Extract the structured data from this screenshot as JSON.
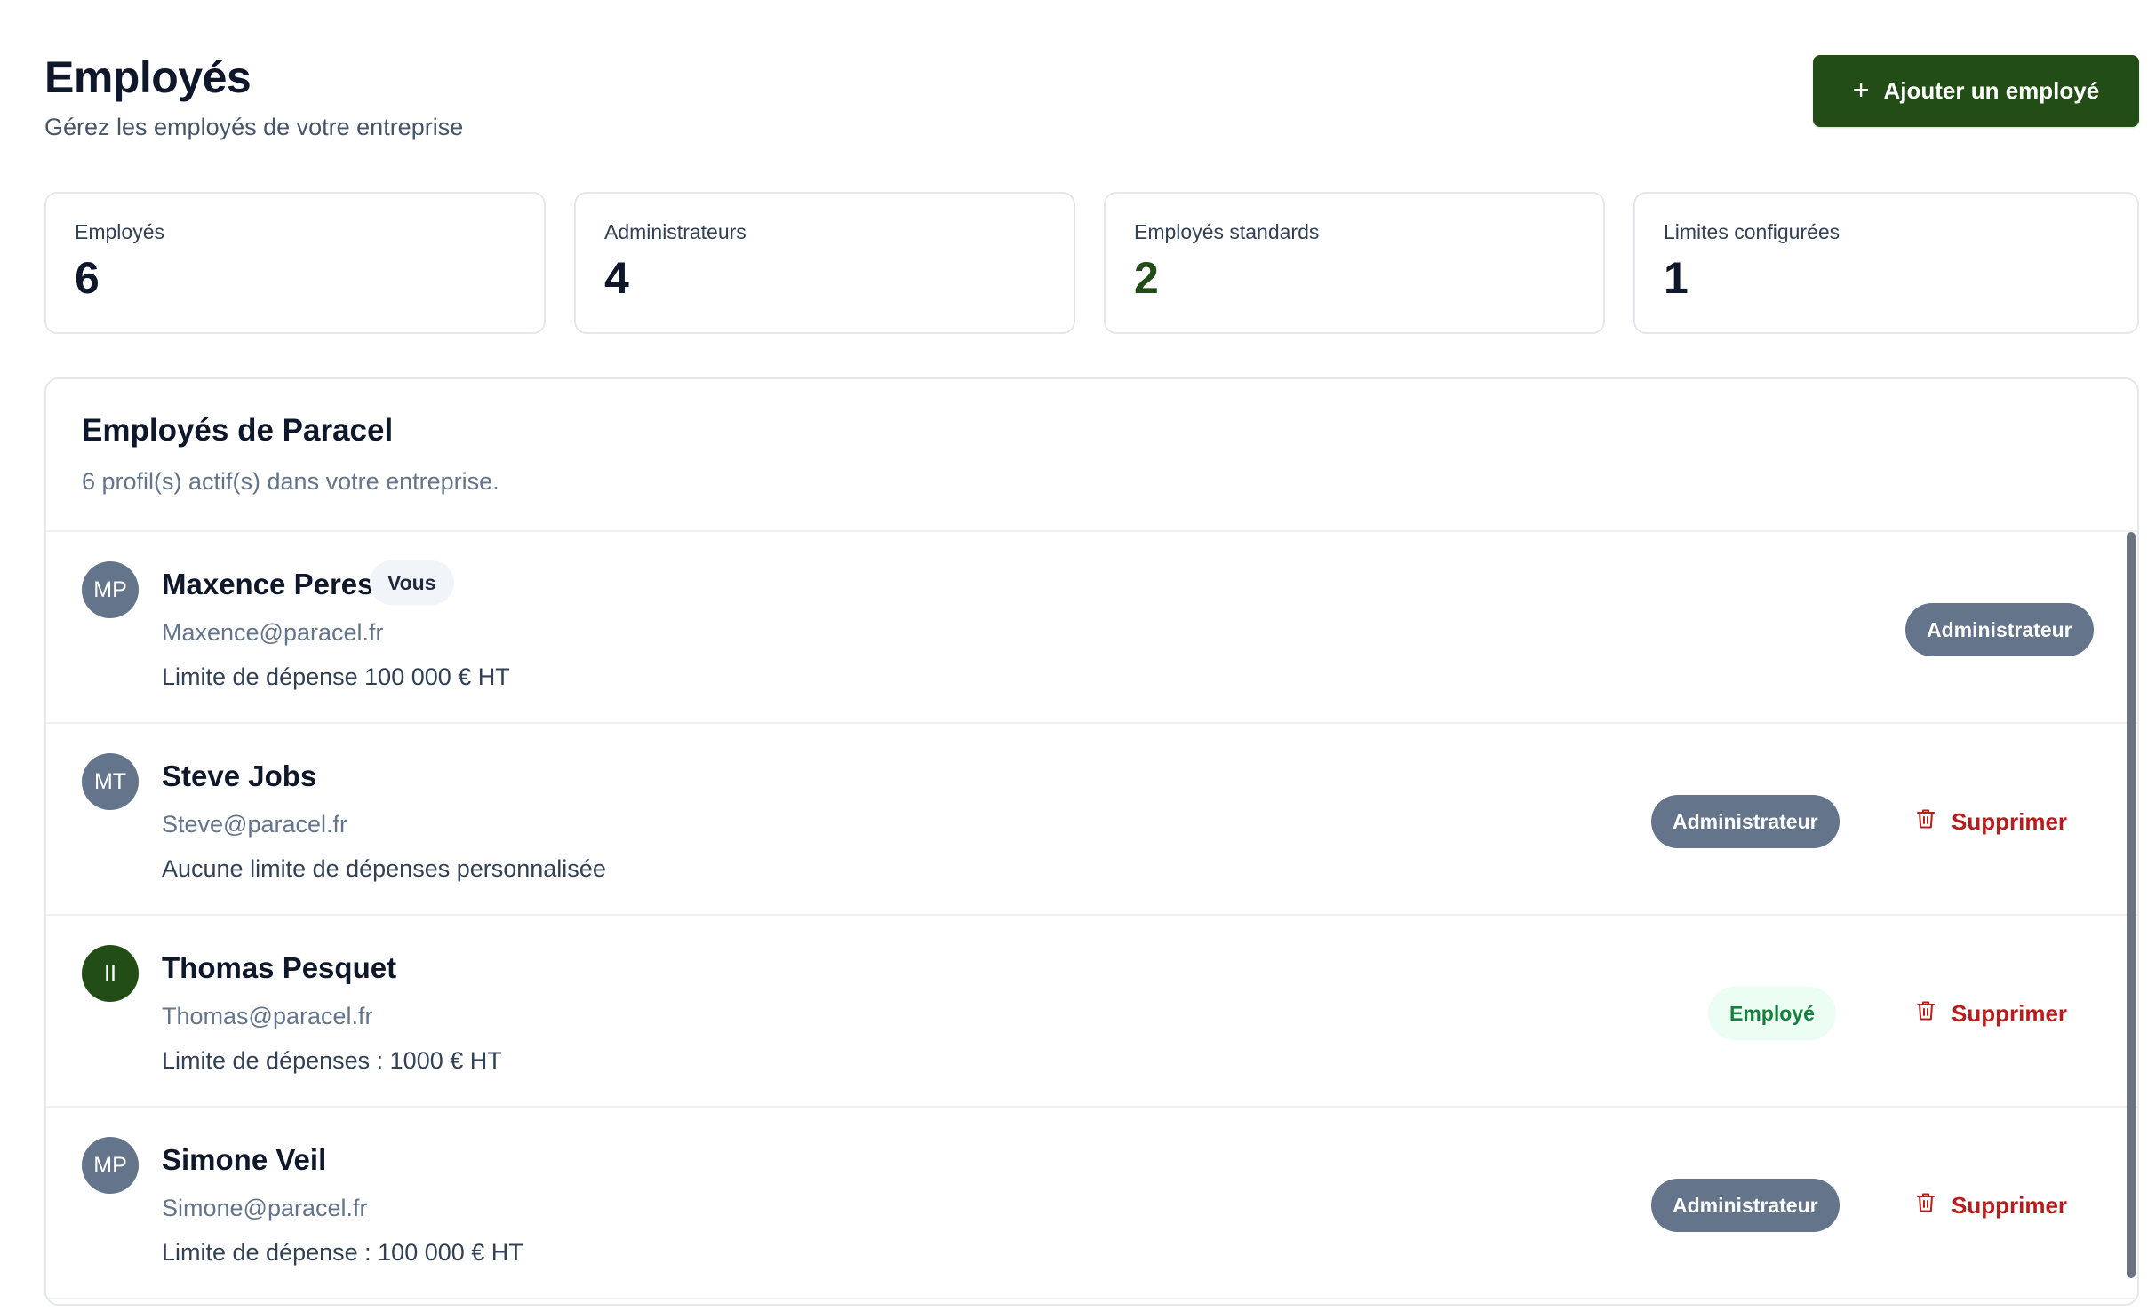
{
  "header": {
    "title": "Employés",
    "subtitle": "Gérez les employés de votre entreprise",
    "add_button_label": "Ajouter un employé"
  },
  "stats": [
    {
      "label": "Employés",
      "value": "6"
    },
    {
      "label": "Administrateurs",
      "value": "4"
    },
    {
      "label": "Employés standards",
      "value": "2",
      "accent": "#234d16"
    },
    {
      "label": "Limites configurées",
      "value": "1"
    }
  ],
  "panel": {
    "title": "Employés de Paracel",
    "description": "6 profil(s) actif(s) dans votre entreprise."
  },
  "employees": [
    {
      "initials": "MP",
      "name": "Maxence Peres",
      "badge": "Vous",
      "email": "Maxence@paracel.fr",
      "limit": "Limite de dépense 100 000 € HT",
      "role": "Administrateur",
      "delete_label": ""
    },
    {
      "initials": "MT",
      "name": "Steve Jobs",
      "badge": "",
      "email": "Steve@paracel.fr",
      "limit": "Aucune limite de dépenses personnalisée",
      "role": "Administrateur",
      "delete_label": "Supprimer"
    },
    {
      "initials": "II",
      "name": "Thomas Pesquet",
      "badge": "",
      "email": "Thomas@paracel.fr",
      "limit": "Limite de dépenses : 1000 € HT",
      "role": "Employé",
      "delete_label": "Supprimer"
    },
    {
      "initials": "MP",
      "name": "Simone Veil",
      "badge": "",
      "email": "Simone@paracel.fr",
      "limit": "Limite de dépense : 100 000 € HT",
      "role": "Administrateur",
      "delete_label": "Supprimer"
    }
  ],
  "colors": {
    "primary": "#234d16",
    "admin_badge": "#64748b",
    "employee_badge_bg": "#ecfdf3",
    "employee_badge_text": "#15803d",
    "danger": "#b91c1c"
  },
  "icons": {
    "add": "plus-icon",
    "delete": "trash-icon"
  }
}
